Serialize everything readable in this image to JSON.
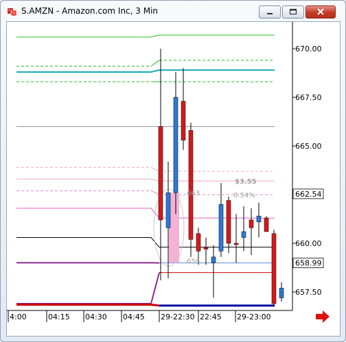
{
  "window": {
    "title": "S.AMZN - Amazon.com Inc, 3 Min",
    "app_icon": "dice-icon",
    "controls": [
      "minimize-icon",
      "maximize-icon",
      "close-icon"
    ]
  },
  "chart_data": {
    "type": "candlestick",
    "title": "S.AMZN - Amazon.com Inc, 3 Min",
    "ylim": [
      656.6,
      671.2
    ],
    "y_ticks": [
      "670.00",
      "667.50",
      "665.00",
      "662.50",
      "660.00",
      "657.50"
    ],
    "y_tick_values": [
      670.0,
      667.5,
      665.0,
      662.5,
      660.0,
      657.5
    ],
    "x_ticks": [
      "4:00",
      "04:15",
      "04:30",
      "04:45",
      "29-22:30",
      "22:45",
      "29-23:00"
    ],
    "price_badges": [
      {
        "label": "662.54",
        "value": 662.54,
        "color": "#ffffff"
      },
      {
        "label": "658.99",
        "value": 658.99,
        "color": "#ffffff"
      }
    ],
    "candles": [
      {
        "open": 661.2,
        "high": 670.0,
        "low": 658.1,
        "close": 666.0,
        "color": "red"
      },
      {
        "open": 660.8,
        "high": 664.2,
        "low": 658.2,
        "close": 662.6,
        "color": "blue"
      },
      {
        "open": 662.6,
        "high": 668.8,
        "low": 661.5,
        "close": 667.5,
        "color": "blue"
      },
      {
        "open": 667.3,
        "high": 669.0,
        "low": 664.8,
        "close": 665.3,
        "color": "red"
      },
      {
        "open": 665.8,
        "high": 666.2,
        "low": 659.3,
        "close": 660.2,
        "color": "red"
      },
      {
        "open": 660.5,
        "high": 660.8,
        "low": 658.9,
        "close": 659.6,
        "color": "red"
      },
      {
        "open": 659.8,
        "high": 660.3,
        "low": 658.9,
        "close": 659.7,
        "color": "red"
      },
      {
        "open": 659.0,
        "high": 659.9,
        "low": 657.2,
        "close": 659.3,
        "color": "blue"
      },
      {
        "open": 659.6,
        "high": 663.1,
        "low": 659.3,
        "close": 662.0,
        "color": "blue"
      },
      {
        "open": 662.2,
        "high": 662.4,
        "low": 659.5,
        "close": 660.0,
        "color": "red"
      },
      {
        "open": 660.0,
        "high": 661.5,
        "low": 659.0,
        "close": 660.0,
        "color": "red"
      },
      {
        "open": 660.3,
        "high": 661.9,
        "low": 659.6,
        "close": 660.6,
        "color": "blue"
      },
      {
        "open": 660.8,
        "high": 661.8,
        "low": 659.4,
        "close": 661.2,
        "color": "red"
      },
      {
        "open": 661.1,
        "high": 662.1,
        "low": 660.3,
        "close": 661.4,
        "color": "blue"
      },
      {
        "open": 661.3,
        "high": 661.4,
        "low": 660.6,
        "close": 660.6,
        "color": "red"
      },
      {
        "open": 660.5,
        "high": 660.7,
        "low": 656.8,
        "close": 656.9,
        "color": "red"
      },
      {
        "open": 657.2,
        "high": 658.0,
        "low": 657.0,
        "close": 657.7,
        "color": "blue"
      }
    ],
    "levels_before": [
      {
        "value": 670.6,
        "color": "#22c022",
        "style": "solid"
      },
      {
        "value": 669.1,
        "color": "#22c022",
        "style": "dash"
      },
      {
        "value": 668.8,
        "color": "#12a8b0",
        "style": "solid",
        "width": 2
      },
      {
        "value": 668.3,
        "color": "#22c022",
        "style": "dash"
      },
      {
        "value": 666.0,
        "color": "#909090",
        "style": "solid"
      },
      {
        "value": 663.9,
        "color": "#f2a6c8",
        "style": "dash"
      },
      {
        "value": 663.3,
        "color": "#f2a6c8",
        "style": "solid"
      },
      {
        "value": 662.7,
        "color": "#e28ad2",
        "style": "dash"
      },
      {
        "value": 661.8,
        "color": "#e060c8",
        "style": "solid"
      },
      {
        "value": 660.3,
        "color": "#000000",
        "style": "solid"
      },
      {
        "value": 659.0,
        "color": "#8a2a8a",
        "style": "solid",
        "width": 2
      },
      {
        "value": 656.9,
        "color": "#8a2a8a",
        "style": "solid",
        "width": 2
      },
      {
        "value": 656.85,
        "color": "#cc0000",
        "style": "solid",
        "width": 3
      }
    ],
    "levels_after": [
      {
        "value": 670.7,
        "color": "#22c022",
        "style": "solid"
      },
      {
        "value": 669.4,
        "color": "#22c022",
        "style": "dash"
      },
      {
        "value": 668.9,
        "color": "#12a8b0",
        "style": "solid",
        "width": 2
      },
      {
        "value": 668.3,
        "color": "#22c022",
        "style": "dash"
      },
      {
        "value": 666.0,
        "color": "#909090",
        "style": "solid"
      },
      {
        "value": 663.7,
        "color": "#f2a6c8",
        "style": "dash"
      },
      {
        "value": 663.2,
        "color": "#f2a6c8",
        "style": "solid"
      },
      {
        "value": 662.5,
        "color": "#e28ad2",
        "style": "dash"
      },
      {
        "value": 661.3,
        "color": "#e060c8",
        "style": "solid"
      },
      {
        "value": 659.8,
        "color": "#000000",
        "style": "solid"
      },
      {
        "value": 658.99,
        "color": "#5a8ad8",
        "style": "solid"
      },
      {
        "value": 658.5,
        "color": "#cc0000",
        "style": "solid"
      },
      {
        "value": 656.8,
        "color": "#0000a0",
        "style": "solid",
        "width": 3
      }
    ],
    "annotations": [
      {
        "text": "663",
        "value": 662.6,
        "color": "#a0a0a0"
      },
      {
        "text": "$3.55",
        "value": 663.2,
        "color": "#a0a0a0"
      },
      {
        "text": "0.54%",
        "value": 662.5,
        "color": "#a0a0a0"
      },
      {
        "text": "659",
        "value": 659.1,
        "color": "#a0a0a0"
      }
    ],
    "highlight_range": {
      "from": 659.0,
      "to": 662.6,
      "color": "#f5b1d6"
    },
    "grid": false,
    "scroll_arrow": "right-arrow-icon"
  }
}
